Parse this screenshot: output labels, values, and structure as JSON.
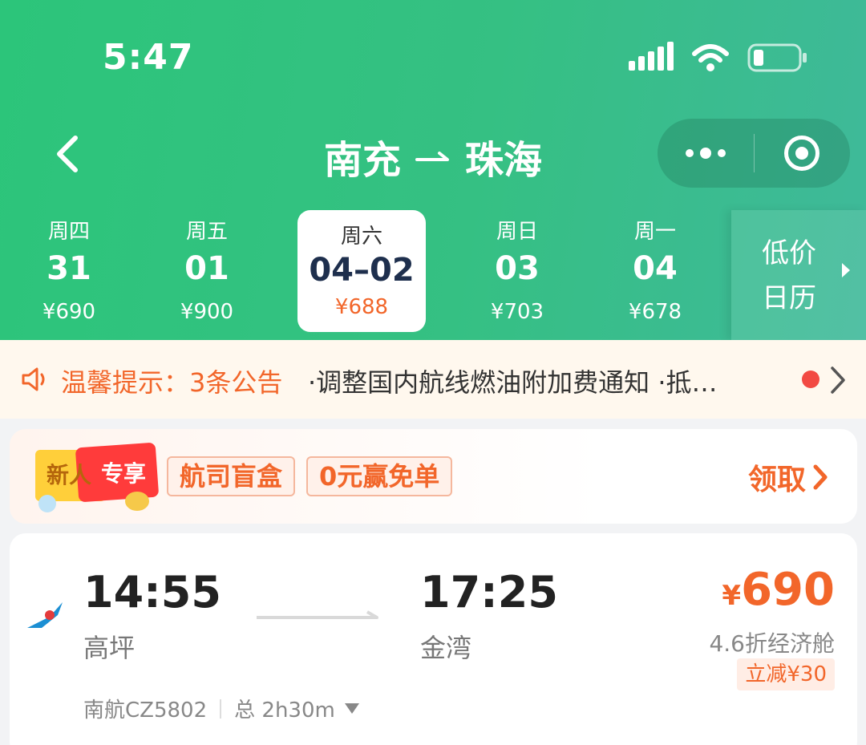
{
  "status": {
    "time": "5:47"
  },
  "nav": {
    "origin": "南充",
    "destination": "珠海"
  },
  "dates": [
    {
      "weekday": "周四",
      "date": "31",
      "price": "¥690"
    },
    {
      "weekday": "周五",
      "date": "01",
      "price": "¥900"
    },
    {
      "weekday": "周六",
      "date": "04–02",
      "price": "¥688",
      "selected": true
    },
    {
      "weekday": "周日",
      "date": "03",
      "price": "¥703"
    },
    {
      "weekday": "周一",
      "date": "04",
      "price": "¥678"
    }
  ],
  "low_price_calendar": {
    "line1": "低价",
    "line2": "日历"
  },
  "notice": {
    "label": "温馨提示：3条公告",
    "message": "·调整国内航线燃油附加费通知 ·抵…"
  },
  "promo": {
    "badge_left": "新人",
    "badge_right": "专享",
    "tags": [
      "航司盲盒",
      "0元赢免单"
    ],
    "cta": "领取"
  },
  "flight": {
    "departure_time": "14:55",
    "departure_airport": "高坪",
    "arrival_time": "17:25",
    "arrival_airport": "金湾",
    "currency": "¥",
    "price": "690",
    "cabin": "4.6折经济舱",
    "discount": "立减¥30",
    "flight_no": "南航CZ5802",
    "duration": "总 2h30m"
  },
  "colors": {
    "header_green": "#2cc57a",
    "accent_orange": "#f2662a",
    "date_navy": "#1e2f4d",
    "notice_bg": "#fff8ee",
    "notice_dot": "#f24a43"
  },
  "icons": [
    "back-icon",
    "route-arrow-icon",
    "more-icon",
    "close-mini-icon",
    "signal-icon",
    "wifi-icon",
    "battery-icon",
    "speaker-icon",
    "chevron-right-icon",
    "airline-logo-icon",
    "dropdown-triangle-icon"
  ]
}
